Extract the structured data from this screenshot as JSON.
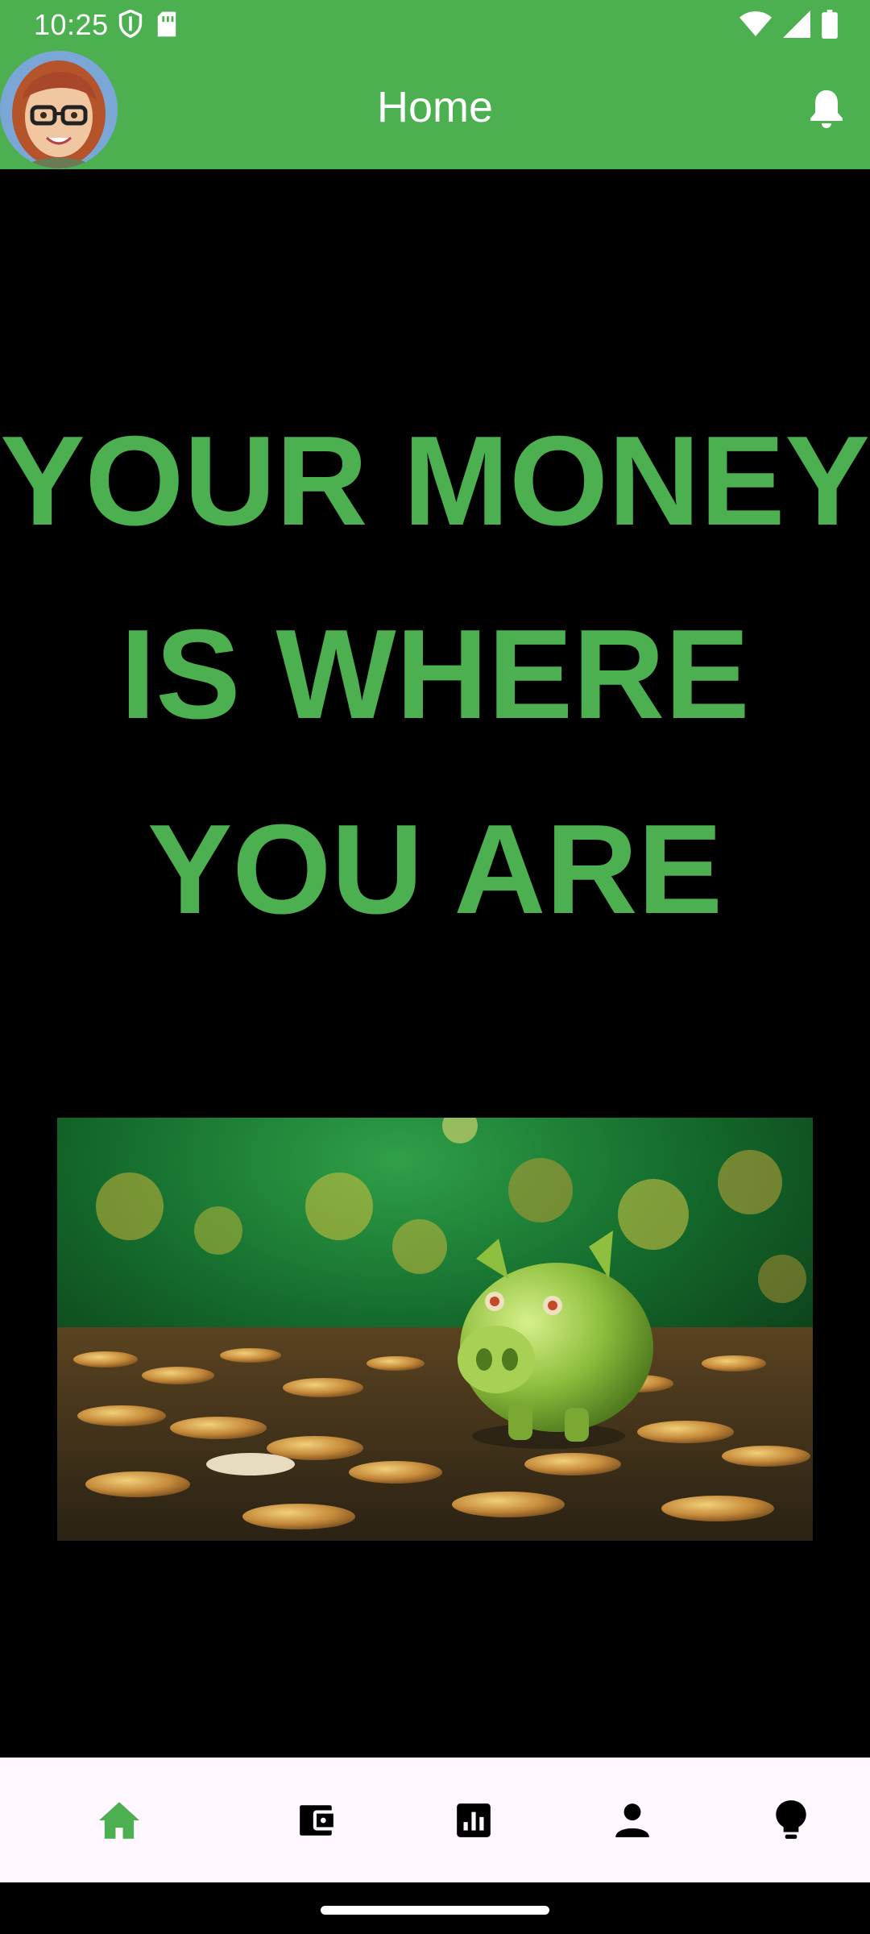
{
  "status_bar": {
    "time": "10:25",
    "left_icons": [
      "shield-icon",
      "sim-card-icon"
    ],
    "right_icons": [
      "wifi-icon",
      "signal-icon",
      "battery-icon"
    ]
  },
  "app_bar": {
    "title": "Home",
    "avatar": "avatar",
    "action_icon": "bell-icon"
  },
  "hero": {
    "line1": "YOUR MONEY",
    "line2": "IS WHERE",
    "line3": "YOU ARE",
    "color": "#4CAF50"
  },
  "promo_image": "piggy-bank-image",
  "bottom_nav": {
    "items": [
      {
        "icon": "home-icon",
        "active": true
      },
      {
        "icon": "wallet-icon",
        "active": false
      },
      {
        "icon": "bar-chart-icon",
        "active": false
      },
      {
        "icon": "person-icon",
        "active": false
      },
      {
        "icon": "lightbulb-icon",
        "active": false
      }
    ],
    "active_color": "#4CAF50",
    "inactive_color": "#000000",
    "background": "#FEF7FF"
  },
  "colors": {
    "primary": "#4CAF50",
    "background": "#000000"
  }
}
